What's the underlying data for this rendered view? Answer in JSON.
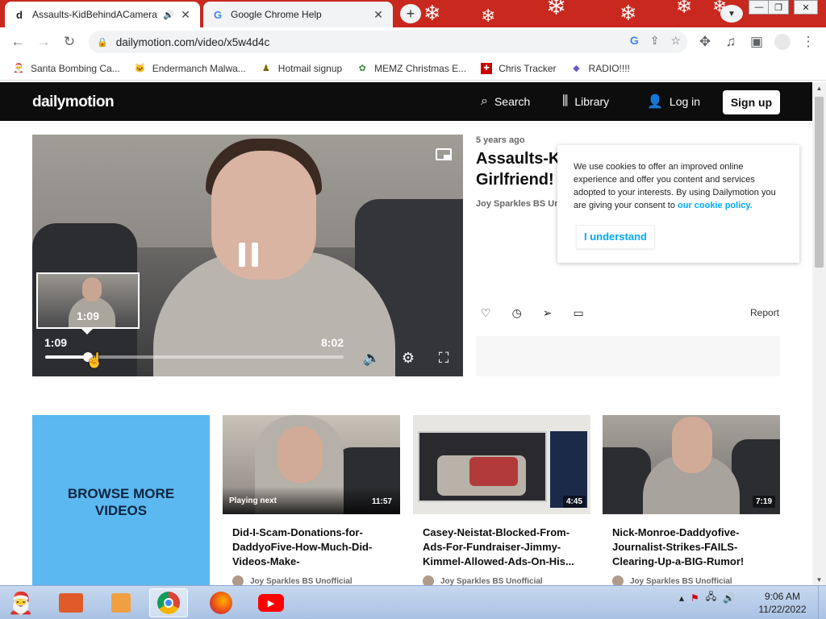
{
  "browser": {
    "tabs": [
      {
        "favicon": "d",
        "title": "Assaults-KidBehindACamera",
        "audio": true,
        "active": true
      },
      {
        "favicon": "G",
        "title": "Google Chrome Help",
        "active": false
      }
    ],
    "new_tab_icon": "+",
    "tab_list_icon": "chevron-down-icon",
    "address": "dailymotion.com/video/x5w4d4c",
    "bookmarks": [
      {
        "label": "Santa Bombing Ca...",
        "icon": "santa-icon"
      },
      {
        "label": "Endermanch Malwa...",
        "icon": "cat-icon"
      },
      {
        "label": "Hotmail signup",
        "icon": "person-icon"
      },
      {
        "label": "MEMZ Christmas E...",
        "icon": "memz-icon"
      },
      {
        "label": "Chris Tracker",
        "icon": "gift-icon"
      },
      {
        "label": "RADIO!!!!",
        "icon": "radio-icon"
      }
    ]
  },
  "site": {
    "logo": "dailymotion",
    "nav": {
      "search": "Search",
      "library": "Library",
      "login": "Log in",
      "signup": "Sign up"
    }
  },
  "player": {
    "current_time": "1:09",
    "duration": "8:02",
    "hover_time": "1:09",
    "progress_fraction": 0.143,
    "state": "playing"
  },
  "video": {
    "age": "5 years ago",
    "title_line1": "Assaults-K",
    "title_line2": "Girlfriend!",
    "channel": "Joy Sparkles BS Unofficial",
    "report": "Report"
  },
  "cookie": {
    "text": "We use cookies to offer an improved online experience and offer you content and services adopted to your interests. By using Dailymotion you are giving your consent to ",
    "link": "our cookie policy.",
    "button": "I understand"
  },
  "browse_more": "BROWSE MORE VIDEOS",
  "cards": [
    {
      "duration": "11:57",
      "badge": "Playing next",
      "title": "Did-I-Scam-Donations-for-DaddyoFive-How-Much-Did-Videos-Make-",
      "channel": "Joy Sparkles BS Unofficial"
    },
    {
      "duration": "4:45",
      "badge": "",
      "title": "Casey-Neistat-Blocked-From-Ads-For-Fundraiser-Jimmy-Kimmel-Allowed-Ads-On-His...",
      "channel": "Joy Sparkles BS Unofficial"
    },
    {
      "duration": "7:19",
      "badge": "",
      "title": "Nick-Monroe-Daddyofive-Journalist-Strikes-FAILS-Clearing-Up-a-BIG-Rumor!",
      "channel": "Joy Sparkles BS Unofficial"
    }
  ],
  "taskbar": {
    "time": "9:06 AM",
    "date": "11/22/2022"
  },
  "colors": {
    "tabstrip": "#c8281e",
    "dm_header": "#0d0d0d",
    "accent": "#00aaff",
    "browse_bg": "#5bb8f0"
  }
}
